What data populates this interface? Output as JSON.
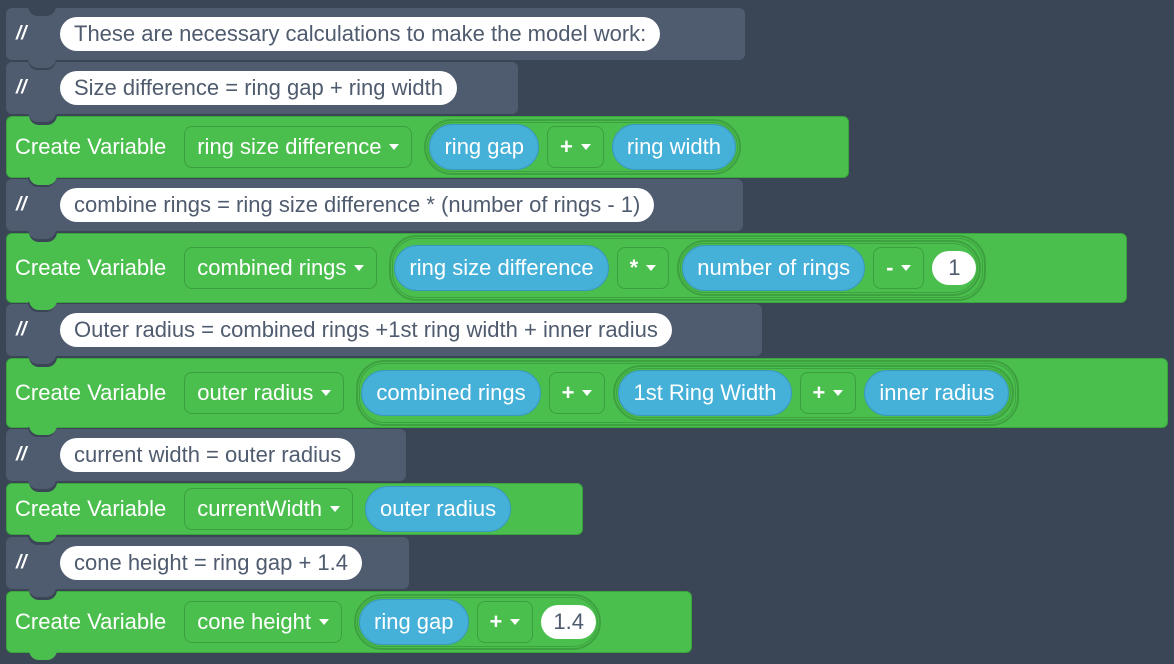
{
  "comments": [
    {
      "slashes": "//",
      "text": "These are necessary calculations to make the model work:"
    },
    {
      "slashes": "//",
      "text": "Size difference = ring gap + ring width"
    },
    {
      "slashes": "//",
      "text": "combine rings =  ring size difference * (number of rings - 1)"
    },
    {
      "slashes": "//",
      "text": "Outer radius = combined rings +1st ring width + inner radius"
    },
    {
      "slashes": "//",
      "text": "current width = outer radius"
    },
    {
      "slashes": "//",
      "text": "cone height = ring gap + 1.4"
    }
  ],
  "create_label": "Create Variable",
  "blocks": [
    {
      "variable": "ring size difference",
      "left": "ring gap",
      "op": "+",
      "right": "ring width"
    },
    {
      "variable": "combined rings",
      "left": "ring size difference",
      "op": "*",
      "inner_left": "number of rings",
      "inner_op": "-",
      "inner_right": "1"
    },
    {
      "variable": "outer radius",
      "left": "combined rings",
      "op": "+",
      "inner_left": "1st Ring Width",
      "inner_op": "+",
      "inner_right": "inner radius"
    },
    {
      "variable": "currentWidth",
      "value": "outer radius"
    },
    {
      "variable": "cone height",
      "left": "ring gap",
      "op": "+",
      "right": "1.4"
    }
  ],
  "colors": {
    "background": "#3a4556",
    "comment_block": "#4f5b6e",
    "create_block": "#4bbf4e",
    "variable_reporter": "#45b0d8"
  }
}
